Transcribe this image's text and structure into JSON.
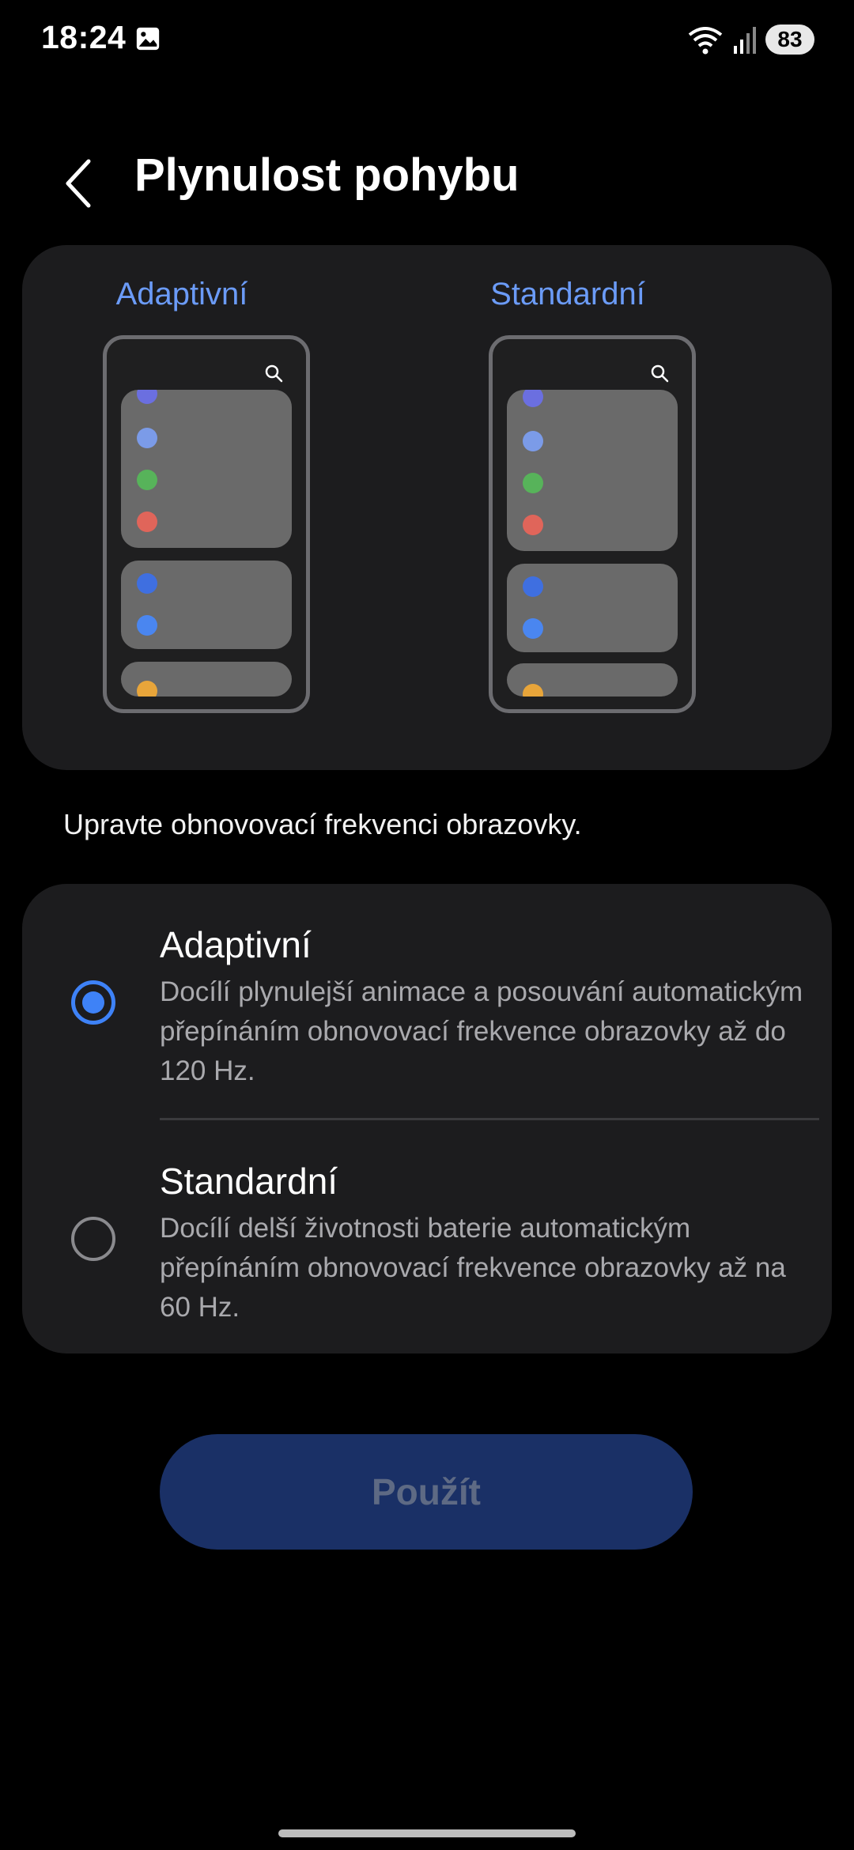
{
  "status_bar": {
    "time": "18:24",
    "battery": "83",
    "icons": [
      "gallery-icon",
      "wifi-icon",
      "signal-icon"
    ]
  },
  "header": {
    "title": "Plynulost pohybu",
    "back_icon": "chevron-left-icon"
  },
  "preview": {
    "adaptive_label": "Adaptivní",
    "standard_label": "Standardní",
    "label_color": "#6b9bf7",
    "dot_colors": [
      "#6b6fe0",
      "#7b9be8",
      "#57b35a",
      "#e0655a",
      "#3f6fe0",
      "#4a86f0",
      "#e8a53a"
    ]
  },
  "description": "Upravte obnovovací frekvenci obrazovky.",
  "options": [
    {
      "title": "Adaptivní",
      "text": "Docílí plynulejší animace a posouvání automatickým přepínáním obnovovací frekvence obrazovky až do 120 Hz.",
      "selected": true
    },
    {
      "title": "Standardní",
      "text": "Docílí delší životnosti baterie automatickým přepínáním obnovovací frekvence obrazovky až na 60 Hz.",
      "selected": false
    }
  ],
  "apply_button": "Použít",
  "colors": {
    "accent": "#3e82f7",
    "card_bg": "#1c1c1e",
    "button_bg": "#1a3066"
  }
}
